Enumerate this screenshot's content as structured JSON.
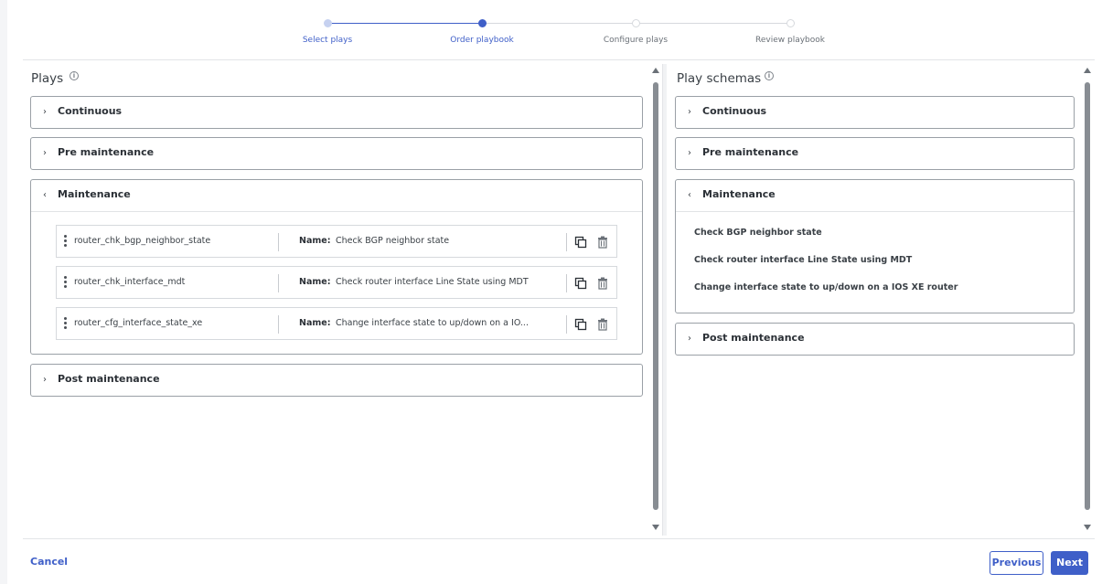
{
  "stepper": {
    "steps": [
      {
        "label": "Select plays",
        "state": "done"
      },
      {
        "label": "Order playbook",
        "state": "current"
      },
      {
        "label": "Configure plays",
        "state": "upcoming"
      },
      {
        "label": "Review playbook",
        "state": "upcoming"
      }
    ]
  },
  "plays_panel": {
    "title": "Plays",
    "info_icon": "info-icon",
    "sections": [
      {
        "title": "Continuous",
        "expanded": false
      },
      {
        "title": "Pre maintenance",
        "expanded": false
      },
      {
        "title": "Maintenance",
        "expanded": true
      },
      {
        "title": "Post maintenance",
        "expanded": false
      }
    ],
    "maintenance_plays": [
      {
        "id": "router_chk_bgp_neighbor_state",
        "name_label": "Name:",
        "name": "Check BGP neighbor state"
      },
      {
        "id": "router_chk_interface_mdt",
        "name_label": "Name:",
        "name": "Check router interface Line State using MDT"
      },
      {
        "id": "router_cfg_interface_state_xe",
        "name_label": "Name:",
        "name": "Change interface state to up/down on a IO..."
      }
    ]
  },
  "schemas_panel": {
    "title": "Play schemas",
    "info_icon": "info-icon",
    "sections": [
      {
        "title": "Continuous",
        "expanded": false
      },
      {
        "title": "Pre maintenance",
        "expanded": false
      },
      {
        "title": "Maintenance",
        "expanded": true
      },
      {
        "title": "Post maintenance",
        "expanded": false
      }
    ],
    "maintenance_items": [
      "Check BGP neighbor state",
      "Check router interface Line State using MDT",
      "Change interface state to up/down on a IOS XE router"
    ]
  },
  "footer": {
    "cancel_label": "Cancel",
    "previous_label": "Previous",
    "next_label": "Next"
  },
  "colors": {
    "accent": "#3f5fc8",
    "border": "#9aa0a6"
  }
}
